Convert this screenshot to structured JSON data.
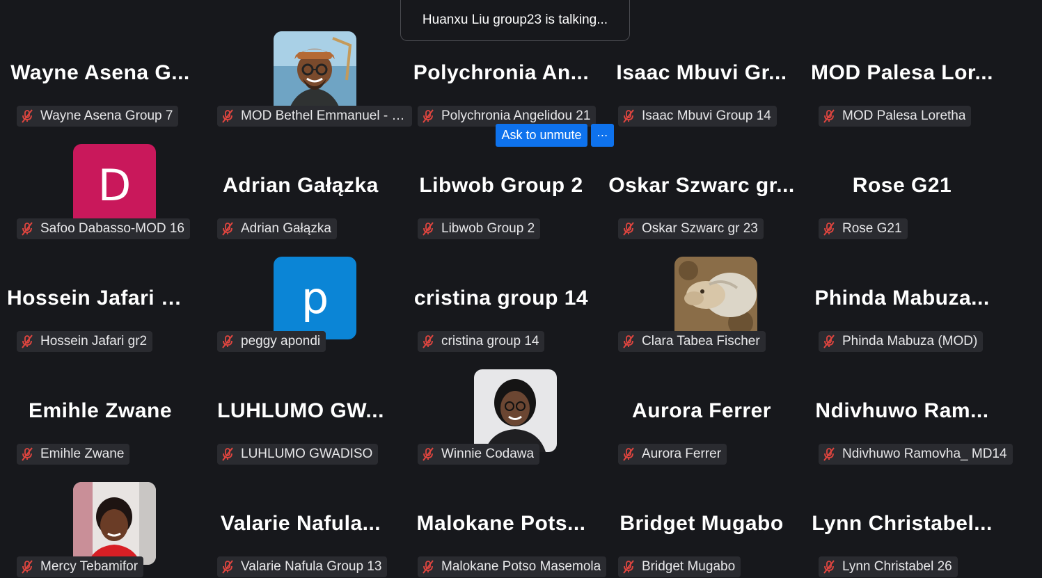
{
  "talking_banner": "Huanxu Liu group23 is talking...",
  "controls": {
    "ask_to_unmute": "Ask to unmute",
    "more": "⋯"
  },
  "colors": {
    "background": "#17181c",
    "accent": "#0e72ed",
    "muted_icon": "#e0453f"
  },
  "participants": [
    {
      "display": "Wayne  Asena  G...",
      "tag": "Wayne Asena Group 7"
    },
    {
      "display": "",
      "tag": "MOD Bethel Emmanuel - Gr...",
      "avatar": "photo-cartoon-man"
    },
    {
      "display": "Polychronia  An...",
      "tag": "Polychronia Angelidou 21"
    },
    {
      "display": "Isaac  Mbuvi  Gr...",
      "tag": "Isaac Mbuvi Group 14"
    },
    {
      "display": "MOD  Palesa  Lor...",
      "tag": "MOD Palesa Loretha"
    },
    {
      "display": "",
      "tag": "Safoo Dabasso-MOD 16",
      "avatar_letter": "D",
      "avatar_color": "#c9185b"
    },
    {
      "display": "Adrian Gałązka",
      "tag": "Adrian Gałązka"
    },
    {
      "display": "Libwob Group 2",
      "tag": "Libwob Group 2"
    },
    {
      "display": "Oskar  Szwarc  gr...",
      "tag": "Oskar Szwarc gr 23"
    },
    {
      "display": "Rose G21",
      "tag": "Rose G21"
    },
    {
      "display": "Hossein Jafari gr2",
      "tag": "Hossein Jafari gr2"
    },
    {
      "display": "",
      "tag": "peggy apondi",
      "avatar_letter": "p",
      "avatar_color": "#0b85d6"
    },
    {
      "display": "cristina group 14",
      "tag": "cristina group 14"
    },
    {
      "display": "",
      "tag": "Clara Tabea Fischer",
      "avatar": "photo-sheep"
    },
    {
      "display": "Phinda  Mabuza...",
      "tag": "Phinda Mabuza (MOD)"
    },
    {
      "display": "Emihle Zwane",
      "tag": "Emihle Zwane"
    },
    {
      "display": "LUHLUMO  GW...",
      "tag": "LUHLUMO GWADISO"
    },
    {
      "display": "",
      "tag": "Winnie Codawa",
      "avatar": "photo-woman"
    },
    {
      "display": "Aurora Ferrer",
      "tag": "Aurora Ferrer"
    },
    {
      "display": "Ndivhuwo  Ram...",
      "tag": "Ndivhuwo Ramovha_ MD14"
    },
    {
      "display": "",
      "tag": "Mercy Tebamifor",
      "avatar": "photo-woman-red"
    },
    {
      "display": "Valarie  Nafula...",
      "tag": "Valarie Nafula Group 13"
    },
    {
      "display": "Malokane  Pots...",
      "tag": "Malokane Potso Masemola"
    },
    {
      "display": "Bridget Mugabo",
      "tag": "Bridget Mugabo"
    },
    {
      "display": "Lynn  Christabel...",
      "tag": "Lynn Christabel 26"
    }
  ]
}
